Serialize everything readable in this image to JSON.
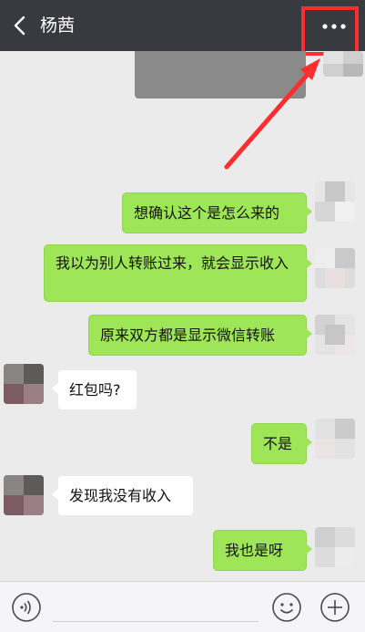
{
  "header": {
    "back_icon": "chevron-left-icon",
    "title": "杨茜",
    "more_icon": "ellipsis-icon",
    "highlight_color": "#ff2d2d"
  },
  "messages": [
    {
      "side": "right",
      "text": "想确认这个是怎么来的"
    },
    {
      "side": "right",
      "text": "我以为别人转账过来，就会显示收入"
    },
    {
      "side": "right",
      "text": "原来双方都是显示微信转账"
    },
    {
      "side": "left",
      "text": "红包吗?"
    },
    {
      "side": "right",
      "text": "不是"
    },
    {
      "side": "left",
      "text": "发现我没有收入"
    },
    {
      "side": "right",
      "text": "我也是呀"
    }
  ],
  "input_bar": {
    "voice_icon": "voice-icon",
    "emoji_icon": "emoji-icon",
    "plus_icon": "plus-icon"
  },
  "colors": {
    "topbar": "#393a3f",
    "chat_background": "#ebebeb",
    "bubble_right": "#9fe558",
    "bubble_left": "#ffffff",
    "annotation_red": "#ff2d2d"
  }
}
